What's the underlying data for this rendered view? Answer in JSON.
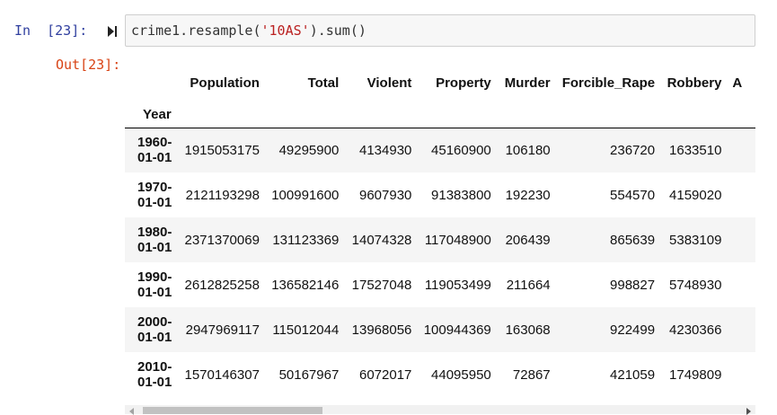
{
  "cell": {
    "in_prompt": "In  [23]:",
    "run_icon": "run-cell-icon",
    "code": {
      "prefix": "crime1.resample(",
      "string_arg": "'10AS'",
      "suffix": ").sum()"
    },
    "out_prompt": "Out[23]:"
  },
  "table": {
    "columns": [
      "Population",
      "Total",
      "Violent",
      "Property",
      "Murder",
      "Forcible_Rape",
      "Robbery",
      "A"
    ],
    "index_name": "Year",
    "rows": [
      {
        "index_line1": "1960-",
        "index_line2": "01-01",
        "values": [
          "1915053175",
          "49295900",
          "4134930",
          "45160900",
          "106180",
          "236720",
          "1633510",
          ""
        ]
      },
      {
        "index_line1": "1970-",
        "index_line2": "01-01",
        "values": [
          "2121193298",
          "100991600",
          "9607930",
          "91383800",
          "192230",
          "554570",
          "4159020",
          ""
        ]
      },
      {
        "index_line1": "1980-",
        "index_line2": "01-01",
        "values": [
          "2371370069",
          "131123369",
          "14074328",
          "117048900",
          "206439",
          "865639",
          "5383109",
          ""
        ]
      },
      {
        "index_line1": "1990-",
        "index_line2": "01-01",
        "values": [
          "2612825258",
          "136582146",
          "17527048",
          "119053499",
          "211664",
          "998827",
          "5748930",
          ""
        ]
      },
      {
        "index_line1": "2000-",
        "index_line2": "01-01",
        "values": [
          "2947969117",
          "115012044",
          "13968056",
          "100944369",
          "163068",
          "922499",
          "4230366",
          ""
        ]
      },
      {
        "index_line1": "2010-",
        "index_line2": "01-01",
        "values": [
          "1570146307",
          "50167967",
          "6072017",
          "44095950",
          "72867",
          "421059",
          "1749809",
          ""
        ]
      }
    ]
  },
  "colors": {
    "in_prompt": "#303f9f",
    "out_prompt": "#d84315",
    "string_literal": "#ba2121",
    "striped_row": "#f5f5f5"
  }
}
